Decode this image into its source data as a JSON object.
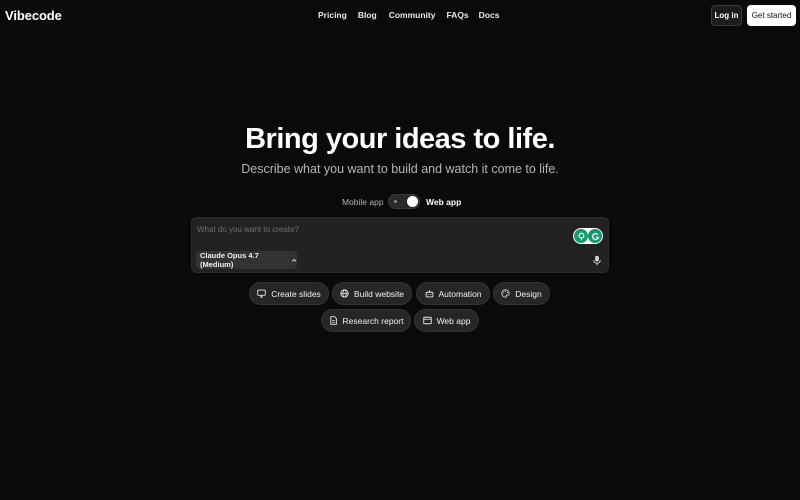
{
  "nav": {
    "logo": "Vibecode",
    "links": [
      "Pricing",
      "Blog",
      "Community",
      "FAQs",
      "Docs"
    ],
    "login_label": "Log in",
    "get_started_label": "Get started"
  },
  "hero": {
    "title": "Bring your ideas to life.",
    "subtitle": "Describe what you want to build and watch it come to life."
  },
  "mode_toggle": {
    "left_label": "Mobile app",
    "right_label": "Web app",
    "selected": "Web app"
  },
  "prompt": {
    "placeholder": "What do you want to create?",
    "value": "",
    "model_label": "Claude Opus 4.7 (Medium)"
  },
  "suggestions": [
    {
      "label": "Create slides",
      "icon": "monitor-icon"
    },
    {
      "label": "Build website",
      "icon": "globe-icon"
    },
    {
      "label": "Automation",
      "icon": "robot-icon"
    },
    {
      "label": "Design",
      "icon": "palette-icon"
    },
    {
      "label": "Research report",
      "icon": "document-icon"
    },
    {
      "label": "Web app",
      "icon": "browser-window-icon"
    }
  ],
  "colors": {
    "background": "#0a0a0a",
    "panel": "#222222",
    "chip": "#262626",
    "accent_green": "#1a9b6e"
  }
}
